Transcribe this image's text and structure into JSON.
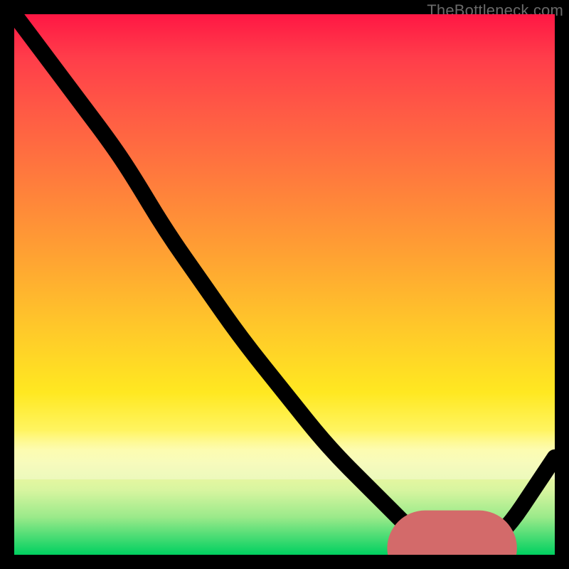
{
  "attribution": "TheBottleneck.com",
  "colors": {
    "gradient_top": "#ff1744",
    "gradient_mid": "#ffe821",
    "gradient_bottom": "#00d060",
    "curve": "#000000",
    "marker": "#d36a6a",
    "frame": "#000000"
  },
  "chart_data": {
    "type": "line",
    "title": "",
    "xlabel": "",
    "ylabel": "",
    "xlim": [
      0,
      100
    ],
    "ylim": [
      0,
      100
    ],
    "grid": false,
    "legend": false,
    "series": [
      {
        "name": "bottleneck-curve",
        "x": [
          0,
          6,
          12,
          18,
          22,
          28,
          35,
          42,
          50,
          58,
          66,
          72,
          76,
          80,
          84,
          88,
          92,
          96,
          100
        ],
        "y": [
          100,
          92,
          84,
          76,
          70,
          60,
          50,
          40,
          30,
          20,
          12,
          6,
          2,
          0,
          0,
          2,
          6,
          12,
          18
        ]
      }
    ],
    "marker": {
      "name": "optimal-range",
      "x_start": 76,
      "x_end": 86,
      "y": 1.2
    },
    "background_gradient_stops": [
      {
        "pct": 0,
        "color": "#ff1744"
      },
      {
        "pct": 30,
        "color": "#ff7a3d"
      },
      {
        "pct": 58,
        "color": "#ffc82a"
      },
      {
        "pct": 78,
        "color": "#fff66a"
      },
      {
        "pct": 93,
        "color": "#9bea8a"
      },
      {
        "pct": 100,
        "color": "#00d060"
      }
    ]
  }
}
